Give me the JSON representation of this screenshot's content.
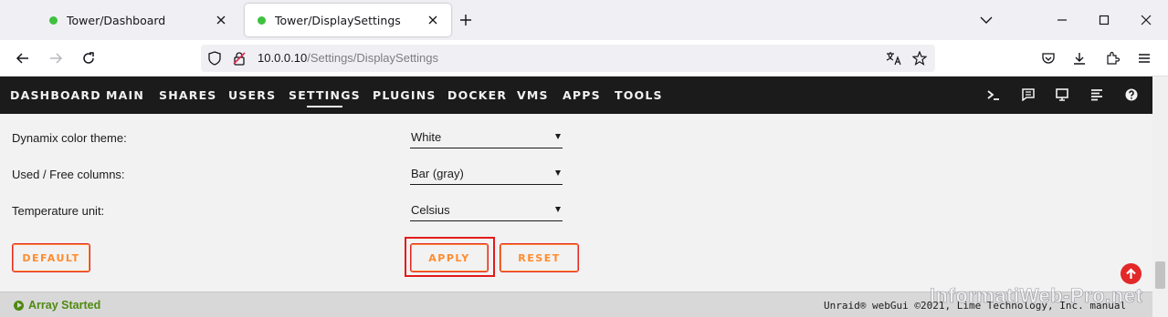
{
  "browser": {
    "tabs": [
      {
        "label": "Tower/Dashboard",
        "active": false
      },
      {
        "label": "Tower/DisplaySettings",
        "active": true
      }
    ],
    "url_host": "10.0.0.10",
    "url_path": "/Settings/DisplaySettings"
  },
  "menu": {
    "items": [
      "DASHBOARD",
      "MAIN",
      "SHARES",
      "USERS",
      "SETTINGS",
      "PLUGINS",
      "DOCKER",
      "VMS",
      "APPS",
      "TOOLS"
    ],
    "active": "SETTINGS",
    "icons": [
      "terminal-icon",
      "log-icon",
      "display-icon",
      "list-icon",
      "help-icon"
    ]
  },
  "settings": {
    "rows": [
      {
        "label": "Dynamix color theme:",
        "value": "White"
      },
      {
        "label": "Used / Free columns:",
        "value": "Bar (gray)"
      },
      {
        "label": "Temperature unit:",
        "value": "Celsius"
      }
    ],
    "default_label": "DEFAULT",
    "apply_label": "APPLY",
    "reset_label": "RESET"
  },
  "footer": {
    "status": "Array Started",
    "copyright": "Unraid® webGui ©2021, Lime Technology, Inc. manual"
  },
  "watermark": "InformatiWeb-Pro.net",
  "colors": {
    "menu_bg": "#1c1b1b",
    "accent_orange": "#ff8c2f",
    "button_border": "#e22828",
    "status_green": "#4f8a10"
  }
}
